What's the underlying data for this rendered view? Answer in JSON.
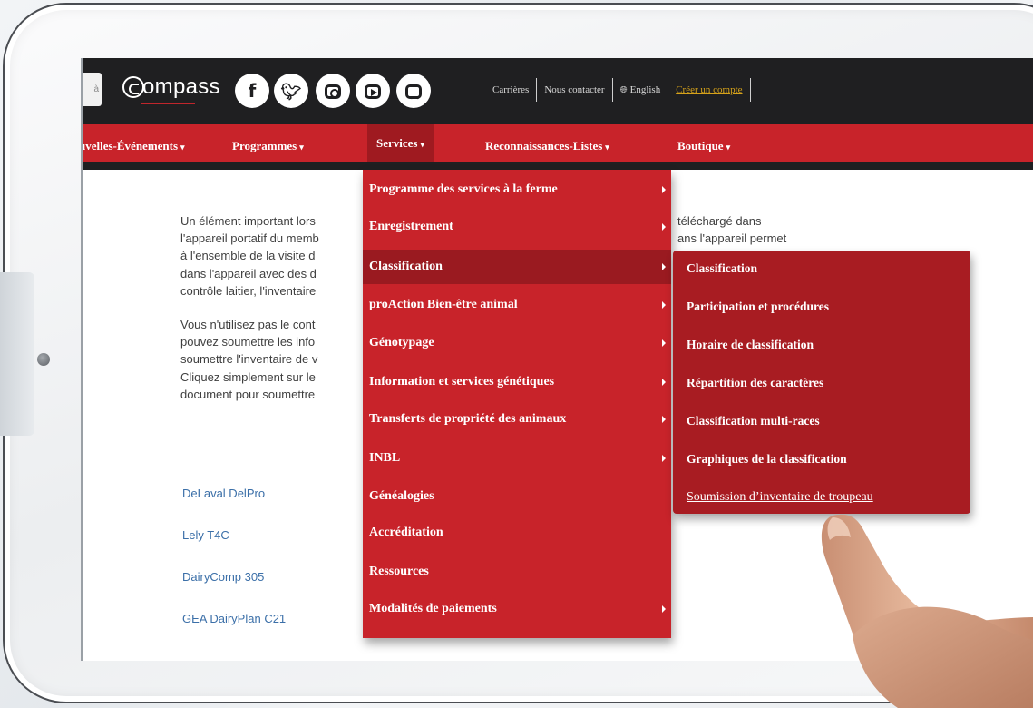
{
  "header": {
    "search_hint": "à",
    "logo_text": "ompass",
    "social_icons": [
      "facebook-icon",
      "twitter-icon",
      "instagram-icon",
      "youtube-icon",
      "flickr-icon"
    ],
    "links": {
      "careers": "Carrières",
      "contact": "Nous contacter",
      "language": "English",
      "create_account": "Créer un compte"
    }
  },
  "nav": {
    "items": [
      "uvelles-Événements",
      "Programmes",
      "Services",
      "Reconnaissances-Listes",
      "Boutique"
    ],
    "active": "Services"
  },
  "services_menu": {
    "items": [
      "Programme des services à la ferme",
      "Enregistrement",
      "Classification",
      "proAction Bien-être animal",
      "Génotypage",
      "Information et services génétiques",
      "Transferts de propriété des animaux",
      "INBL",
      "Généalogies",
      "Accréditation",
      "Ressources",
      "Modalités de paiements"
    ],
    "highlighted": "Classification"
  },
  "classification_menu": {
    "items": [
      "Classification",
      "Participation et procédures",
      "Horaire de classification",
      "Répartition des caractères",
      "Classification multi-races",
      "Graphiques de la classification",
      "Soumission d’inventaire de troupeau"
    ]
  },
  "body": {
    "para1_lines": [
      "Un élément important lors",
      "l'appareil portatif du memb",
      "à l'ensemble de la visite d",
      "dans l'appareil avec des d",
      "contrôle laitier, l'inventaire"
    ],
    "para1_right": [
      "téléchargé dans",
      "ans l'appareil permet"
    ],
    "para2_lines": [
      "Vous n'utilisez pas le cont",
      "pouvez soumettre les info",
      "soumettre l'inventaire de v",
      "Cliquez simplement sur le",
      "document pour soumettre"
    ],
    "links": [
      "DeLaval DelPro",
      "Lely T4C",
      "DairyComp 305",
      "GEA DairyPlan C21"
    ]
  },
  "colors": {
    "nav_red": "#c8232a",
    "active_red": "#9f1a20",
    "submenu_red": "#a81c22",
    "topbar": "#1f1f21",
    "link_blue": "#3b6fa8",
    "create_gold": "#d6a21a"
  }
}
